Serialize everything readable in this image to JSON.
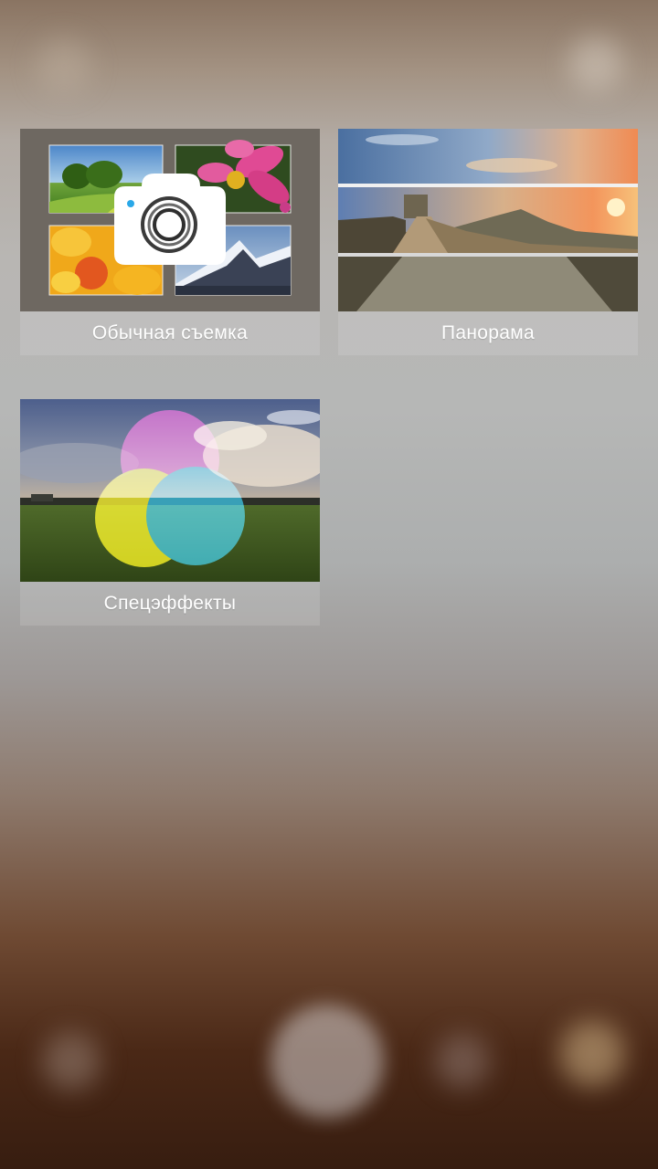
{
  "modes": [
    {
      "label": "Обычная съемка",
      "icon": "camera-icon"
    },
    {
      "label": "Панорама",
      "icon": "panorama-icon"
    },
    {
      "label": "Спецэффекты",
      "icon": "color-filter-icon"
    }
  ],
  "colors": {
    "tile_label_text": "#ffffff",
    "label_bar": "rgba(255,255,255,0.12)",
    "effect_magenta": "#c2189a",
    "effect_yellow": "#e8e00a",
    "effect_cyan": "#12a2c8"
  }
}
